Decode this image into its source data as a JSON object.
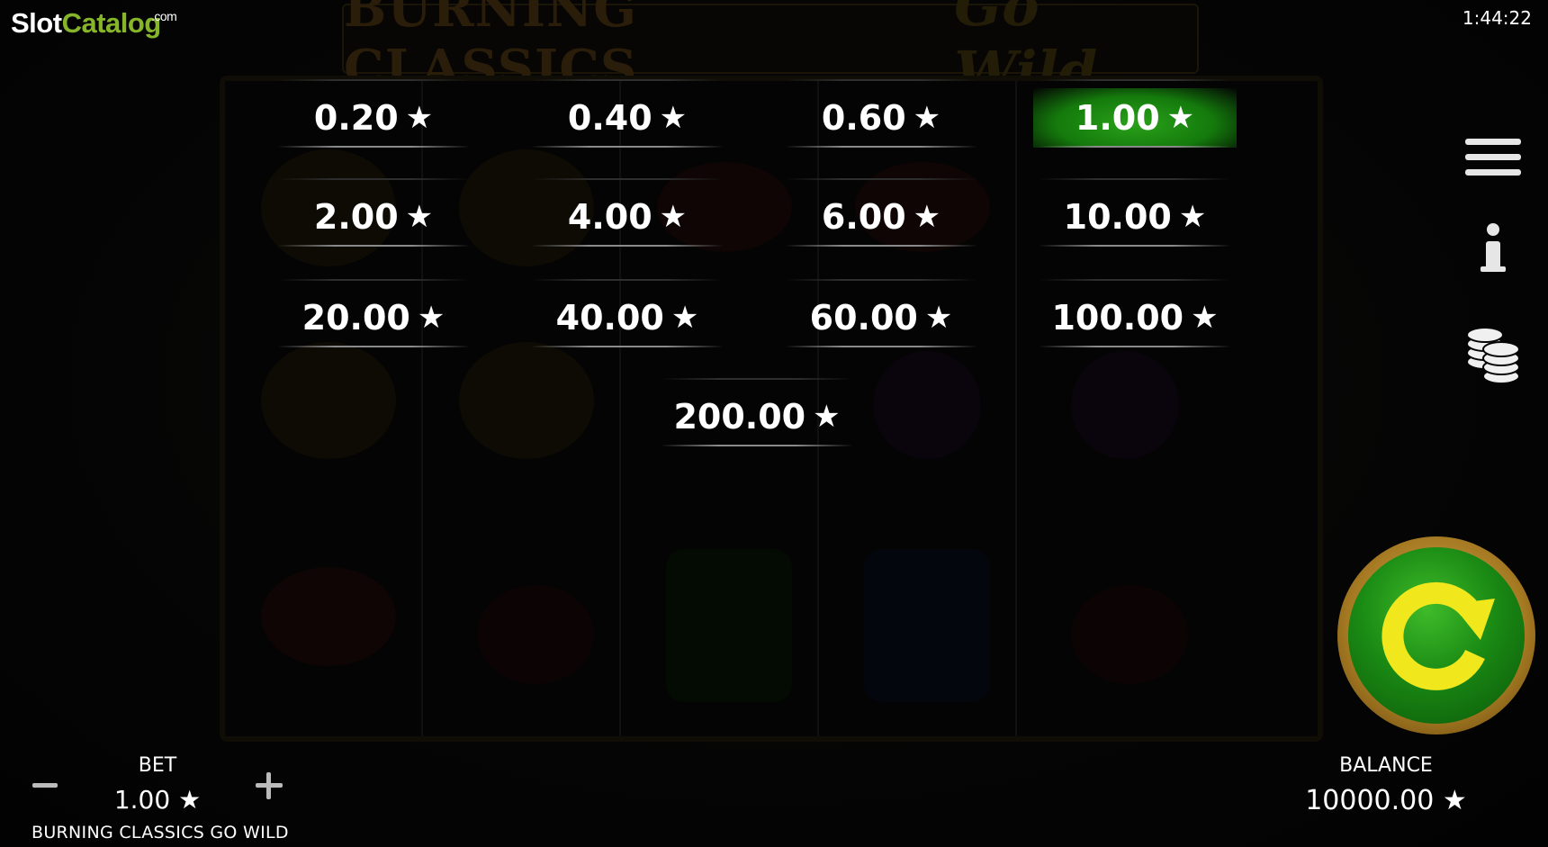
{
  "logo": {
    "slot": "Slot",
    "catalog": "Catalog",
    "dotcom": ".com"
  },
  "clock": "1:44:22",
  "game_title": {
    "part1": "BURNING CLASSICS",
    "part2": "Go Wild"
  },
  "currency_symbol": "★",
  "bet_options": [
    {
      "value": "0.20",
      "selected": false
    },
    {
      "value": "0.40",
      "selected": false
    },
    {
      "value": "0.60",
      "selected": false
    },
    {
      "value": "1.00",
      "selected": true
    },
    {
      "value": "2.00",
      "selected": false
    },
    {
      "value": "4.00",
      "selected": false
    },
    {
      "value": "6.00",
      "selected": false
    },
    {
      "value": "10.00",
      "selected": false
    },
    {
      "value": "20.00",
      "selected": false
    },
    {
      "value": "40.00",
      "selected": false
    },
    {
      "value": "60.00",
      "selected": false
    },
    {
      "value": "100.00",
      "selected": false
    },
    {
      "value": "200.00",
      "selected": false
    }
  ],
  "side_icons": [
    "menu-icon",
    "info-icon",
    "coins-icon"
  ],
  "spin_icon": "spin-arrow-icon",
  "bottom": {
    "bet_label": "BET",
    "bet_value": "1.00",
    "game_name": "BURNING CLASSICS GO WILD",
    "balance_label": "BALANCE",
    "balance_value": "10000.00"
  },
  "colors": {
    "selected_bet": "#1f8f14",
    "logo_green": "#86b52a",
    "spin_gold": "#c49334",
    "spin_green": "#1a8a14",
    "spin_arrow": "#f0e81c"
  }
}
